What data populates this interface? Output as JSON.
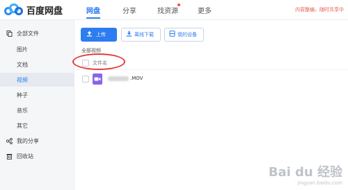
{
  "app": {
    "name": "百度网盘",
    "nav": [
      "网盘",
      "分享",
      "找资源",
      "更多"
    ],
    "notice": "内容整编，随时共享中"
  },
  "sidebar": {
    "items": [
      {
        "label": "全部文件",
        "icon": "file-stack-icon"
      },
      {
        "label": "图片"
      },
      {
        "label": "文档"
      },
      {
        "label": "视频"
      },
      {
        "label": "种子"
      },
      {
        "label": "音乐"
      },
      {
        "label": "其它"
      },
      {
        "label": "我的分享",
        "icon": "share-icon"
      },
      {
        "label": "回收站",
        "icon": "trash-icon"
      }
    ],
    "active_index": 3
  },
  "toolbar": {
    "upload_label": "上传",
    "offline_label": "离线下载",
    "devices_label": "我的设备"
  },
  "breadcrumb": "全部视频",
  "table": {
    "name_header": "文件名",
    "files": [
      {
        "name_suffix": ".MOV",
        "type": "video",
        "icon": "video-file-icon"
      }
    ]
  },
  "watermark": {
    "main": "Bai du 经验",
    "sub": "jingyan.baidu.com"
  },
  "colors": {
    "accent": "#2d7cf0",
    "annotation": "#e23b3b",
    "video_icon": "#8a63e8"
  }
}
